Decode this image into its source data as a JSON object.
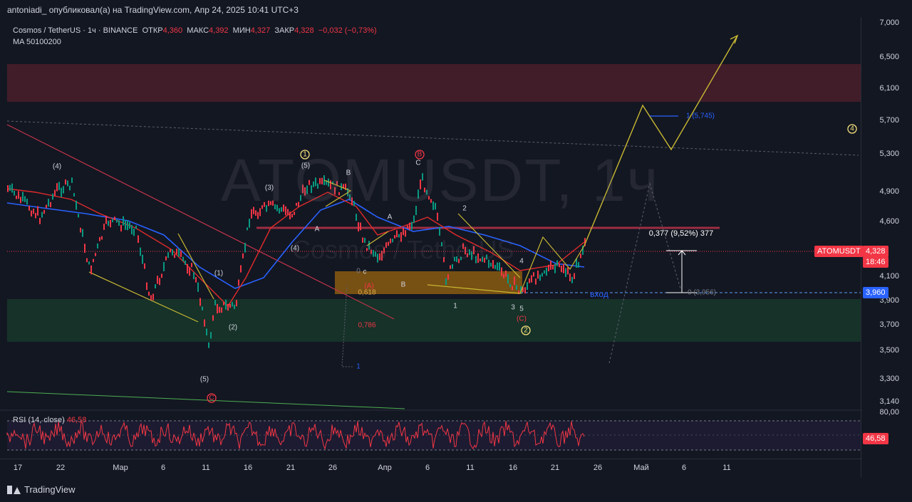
{
  "header": {
    "author_line": "antoniadi_ опубликовал(а) на TradingView.com, Апр 24, 2025 10:41 UTC+3"
  },
  "legend": {
    "symbol": "Cosmos / TetherUS · 1ч · BINANCE",
    "open_label": "ОТКР",
    "open": "4,360",
    "high_label": "МАКС",
    "high": "4,392",
    "low_label": "МИН",
    "low": "4,327",
    "close_label": "ЗАКР",
    "close": "4,328",
    "change": "−0,032 (−0,73%)",
    "ma": "MA 50100200"
  },
  "watermark": {
    "main": "ATOMUSDT, 1ч",
    "sub": "Cosmos / TetherUS"
  },
  "price_axis": [
    "7,000",
    "6,500",
    "6,100",
    "5,700",
    "5,300",
    "4,900",
    "4,600",
    "4,328",
    "4,100",
    "3,960",
    "3,900",
    "3,700",
    "3,500",
    "3,300",
    "3,140"
  ],
  "time_axis": [
    "17",
    "22",
    "Мар",
    "6",
    "11",
    "16",
    "21",
    "26",
    "Апр",
    "6",
    "11",
    "16",
    "21",
    "26",
    "Май",
    "6",
    "11"
  ],
  "price_tags": {
    "symbol": "ATOMUSDT",
    "last": "4,328",
    "countdown": "18:46",
    "entry": "3,960",
    "rsi": "46,58",
    "rsi_upper": "80,00"
  },
  "annotations": {
    "target": "1 (5,745)",
    "measure": "0,377 (9,52%) 377",
    "entry_label": "вход",
    "entry_level": "0 (3,956)",
    "fib_0": "0",
    "fib_0618": "0,618",
    "fib_0786": "0,786",
    "fib_1": "1",
    "circle_1": "1",
    "circle_2": "2",
    "circle_4": "4",
    "circle_b": "B",
    "circle_c": "C",
    "wave_4a": "(4)",
    "wave_5a": "(5)",
    "wave_3": "(3)",
    "wave_4b": "(4)",
    "wave_1": "(1)",
    "wave_2": "(2)",
    "wave_5b": "(5)",
    "wave_A": "A",
    "wave_B": "B",
    "wave_C": "C",
    "wave_A2": "A",
    "wave_B2": "B",
    "wave_paren_a": "(A)",
    "wave_c_small": "c",
    "wave_paren_c": "(C)",
    "n1": "1",
    "n2": "2",
    "n3": "3",
    "n4": "4",
    "n5": "5"
  },
  "rsi": {
    "label": "RSI (14, close)",
    "value": "46,58"
  },
  "footer": {
    "brand": "TradingView"
  },
  "colors": {
    "bg": "#131722",
    "down": "#f23645",
    "up": "#089981",
    "ma_red": "#e02b2b",
    "ma_blue": "#2962ff",
    "wave": "#c8b832"
  }
}
